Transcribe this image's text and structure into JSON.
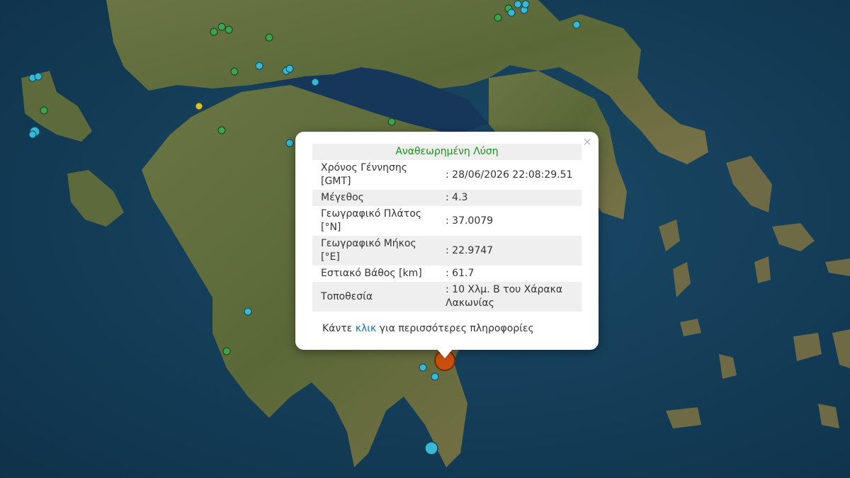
{
  "popup": {
    "title": "Αναθεωρημένη Λύση",
    "close_label": "×",
    "rows": [
      {
        "label": "Χρόνος Γέννησης [GMT]",
        "value": ": 28/06/2026 22:08:29.51"
      },
      {
        "label": "Μέγεθος",
        "value": ": 4.3"
      },
      {
        "label": "Γεωγραφικό Πλάτος [°N]",
        "value": ": 37.0079"
      },
      {
        "label": "Γεωγραφικό Μήκος [°E]",
        "value": ": 22.9747"
      },
      {
        "label": "Εστιακό Βάθος [km]",
        "value": ": 61.7"
      },
      {
        "label": "Τοποθεσία",
        "value": ": 10 Χλμ. Β του Χάρακα Λακωνίας"
      }
    ],
    "footer_prefix": "Κάντε",
    "footer_link": "κλικ",
    "footer_suffix": "για περισσότερες πληροφορίες"
  },
  "colors": {
    "sea": "#123a55",
    "land": "#5b6a3a",
    "main_event": "#c8500e",
    "recent_event": "#37b9d6",
    "older_event": "#3ca44c",
    "yellow_event": "#d8c23a"
  }
}
